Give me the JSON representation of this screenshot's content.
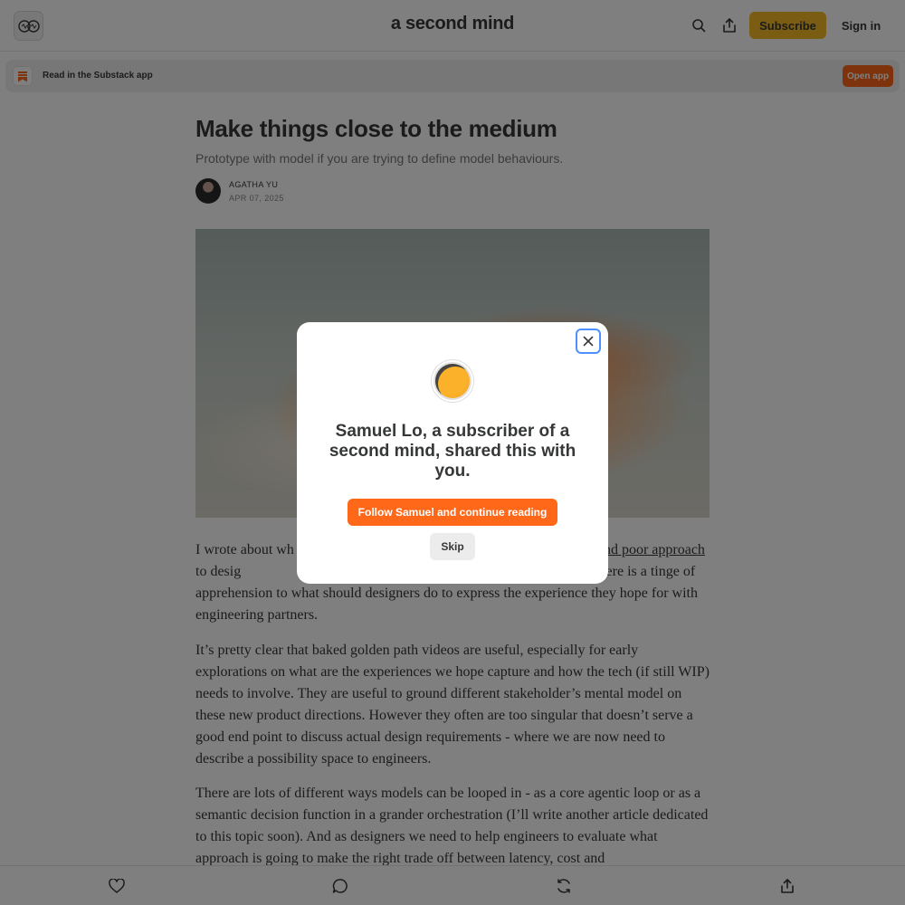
{
  "header": {
    "publication_title": "a second mind",
    "logo_icon": "mind-logo-icon",
    "search_icon": "search-icon",
    "share_icon": "share-icon",
    "subscribe_label": "Subscribe",
    "signin_label": "Sign in"
  },
  "app_banner": {
    "icon": "substack-bookmark-icon",
    "text": "Read in the Substack app",
    "open_label": "Open app"
  },
  "article": {
    "title": "Make things close to the medium",
    "subtitle": "Prototype with model if you are trying to define model behaviours.",
    "author": "AGATHA YU",
    "date": "APR 07, 2025",
    "paragraphs": [
      {
        "before": "I wrote about wh",
        "link": "and poor approach",
        "after": " to desig",
        "tail": "ce is that there is a tinge of apprehension to what should designers do to express the experience they hope for with engineering partners."
      },
      "It’s pretty clear that baked golden path videos are useful, especially for early explorations on what are the experiences we hope capture and how the tech (if still WIP) needs to involve. They are useful to ground different stakeholder’s mental model on these new product directions. However they often are too singular that doesn’t serve a good end point to discuss actual design requirements - where we are now need to describe a possibility space to engineers.",
      "There are lots of different ways models can be looped in - as a core agentic loop or as a semantic decision function in a grander orchestration (I’ll write another article dedicated to this topic soon). And as designers we need to help engineers to evaluate what approach is going to make the right trade off between latency, cost and"
    ]
  },
  "bottom_bar": {
    "like_icon": "heart-icon",
    "comment_icon": "comment-icon",
    "restack_icon": "restack-icon",
    "share_icon": "share-icon"
  },
  "modal": {
    "title": "Samuel Lo, a subscriber of a second mind, shared this with you.",
    "follow_label": "Follow Samuel and continue reading",
    "skip_label": "Skip",
    "close_icon": "close-icon"
  },
  "colors": {
    "accent": "#ff6719",
    "subscribe": "#f4bb27",
    "overlay": "rgba(0,0,0,0.5)"
  }
}
